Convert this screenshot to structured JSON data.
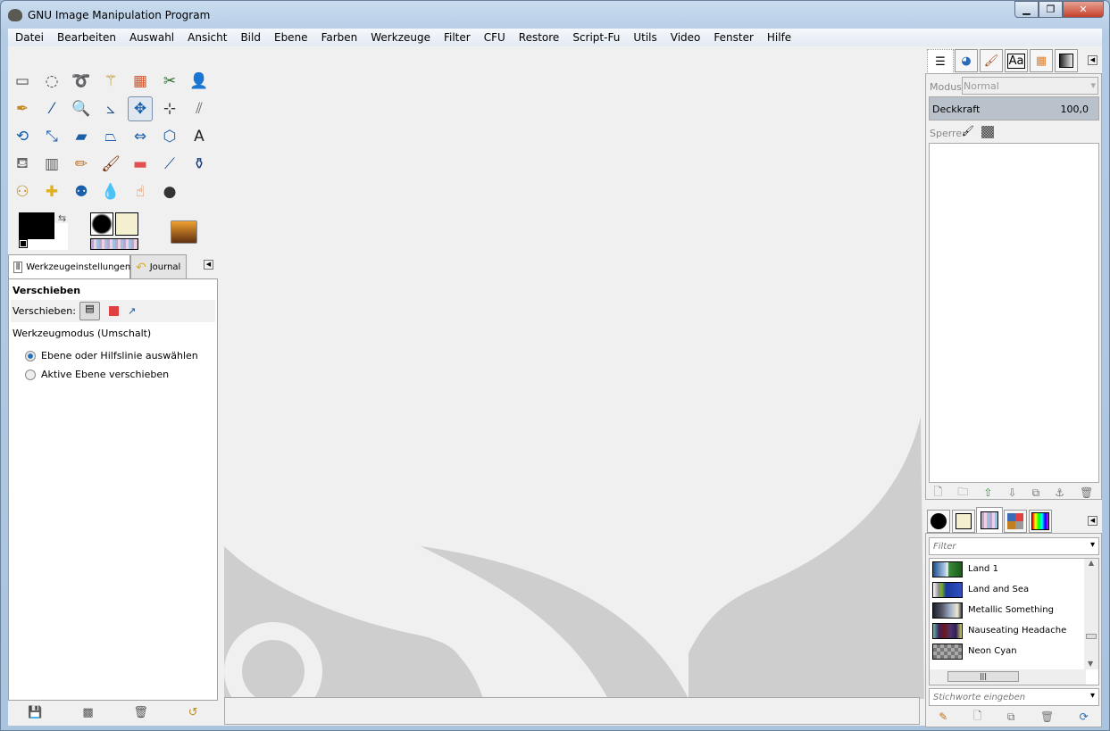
{
  "window": {
    "title": "GNU Image Manipulation Program",
    "minimize": "▁",
    "maximize": "❐",
    "close": "✕"
  },
  "menu": [
    "Datei",
    "Bearbeiten",
    "Auswahl",
    "Ansicht",
    "Bild",
    "Ebene",
    "Farben",
    "Werkzeuge",
    "Filter",
    "CFU",
    "Restore",
    "Script-Fu",
    "Utils",
    "Video",
    "Fenster",
    "Hilfe"
  ],
  "toolbox": {
    "tools": [
      [
        {
          "n": "rect-select",
          "g": "▭",
          "c": "#444"
        },
        {
          "n": "ellipse-select",
          "g": "◌",
          "c": "#444"
        },
        {
          "n": "free-select",
          "g": "➰",
          "c": "#555"
        },
        {
          "n": "fuzzy-select",
          "g": "⚚",
          "c": "#b98a1a"
        },
        {
          "n": "color-select",
          "g": "▦",
          "c": "#d2532a"
        },
        {
          "n": "scissors",
          "g": "✂",
          "c": "#2b6c2b"
        },
        {
          "n": "foreground-select",
          "g": "👤",
          "c": "#3366aa"
        }
      ],
      [
        {
          "n": "paths",
          "g": "✒",
          "c": "#c08a20"
        },
        {
          "n": "color-picker",
          "g": "⁄",
          "c": "#1a4f8f"
        },
        {
          "n": "zoom",
          "g": "🔍",
          "c": "#3a6aa8"
        },
        {
          "n": "measure",
          "g": "⦣",
          "c": "#1a4f8f"
        },
        {
          "n": "move",
          "g": "✥",
          "c": "#1a5fa8"
        },
        {
          "n": "align",
          "g": "⊹",
          "c": "#333"
        },
        {
          "n": "shear",
          "g": "⫽",
          "c": "#666"
        }
      ],
      [
        {
          "n": "rotate",
          "g": "⟲",
          "c": "#1a5fa8"
        },
        {
          "n": "scale",
          "g": "⤡",
          "c": "#1a5fa8"
        },
        {
          "n": "shear-tool",
          "g": "▰",
          "c": "#1a5fa8"
        },
        {
          "n": "perspective",
          "g": "⏢",
          "c": "#1a5fa8"
        },
        {
          "n": "flip",
          "g": "⇔",
          "c": "#1a5fa8"
        },
        {
          "n": "cage-transform",
          "g": "⬡",
          "c": "#1a5fa8"
        },
        {
          "n": "text",
          "g": "A",
          "c": "#222"
        }
      ],
      [
        {
          "n": "bucket-fill",
          "g": "⛾",
          "c": "#666"
        },
        {
          "n": "blend",
          "g": "▥",
          "c": "#555"
        },
        {
          "n": "pencil",
          "g": "✏",
          "c": "#c07020"
        },
        {
          "n": "paintbrush",
          "g": "🖌",
          "c": "#703010"
        },
        {
          "n": "eraser",
          "g": "▬",
          "c": "#e05050"
        },
        {
          "n": "airbrush",
          "g": "⟋",
          "c": "#1a4f8f"
        },
        {
          "n": "ink",
          "g": "⚱",
          "c": "#1a3f7f"
        }
      ],
      [
        {
          "n": "clone",
          "g": "⚇",
          "c": "#c08a20"
        },
        {
          "n": "heal",
          "g": "✚",
          "c": "#e0b020"
        },
        {
          "n": "perspective-clone",
          "g": "⚉",
          "c": "#1a5fa8"
        },
        {
          "n": "blur",
          "g": "💧",
          "c": "#3a7ab8"
        },
        {
          "n": "smudge",
          "g": "☝",
          "c": "#d07030"
        },
        {
          "n": "dodge-burn",
          "g": "●",
          "c": "#333"
        }
      ]
    ]
  },
  "tool_options": {
    "tab_active": "Werkzeugeinstellungen",
    "tab_other": "Journal",
    "title": "Verschieben",
    "move_label": "Verschieben:",
    "mode_label": "Werkzeugmodus (Umschalt)",
    "options": [
      {
        "label": "Ebene oder Hilfslinie auswählen",
        "selected": true
      },
      {
        "label": "Aktive Ebene verschieben",
        "selected": false
      }
    ]
  },
  "layers": {
    "mode_label": "Modus:",
    "mode_value": "Normal",
    "opacity_label": "Deckkraft",
    "opacity_value": "100,0",
    "lock_label": "Sperre:"
  },
  "gradients": {
    "filter_placeholder": "Filter",
    "tags_placeholder": "Stichworte eingeben",
    "items": [
      {
        "name": "Land 1",
        "bg": "linear-gradient(90deg,#1a4f8f,#bcd4ea 45%,#fff 50%,#3a8a3a 55%,#1a5a1a)"
      },
      {
        "name": "Land and Sea",
        "bg": "linear-gradient(90deg,#fff,#888 20%,#7ab020 30%,#1a3a9f 45%,#3050c0)"
      },
      {
        "name": "Metallic Something",
        "bg": "linear-gradient(90deg,#1a2030,#556 30%,#a0b0c8 60%,#f0e8d0 85%,#334)"
      },
      {
        "name": "Nauseating Headache",
        "bg": "linear-gradient(90deg,#60c0a0,#402060 20%,#701818 40%,#503070 60%,#302050 80%,#d0d070)"
      },
      {
        "name": "Neon Cyan",
        "bg": "repeating-conic-gradient(#777 0 25%,#aaa 0 50%) 0 0/8px 8px"
      }
    ]
  }
}
